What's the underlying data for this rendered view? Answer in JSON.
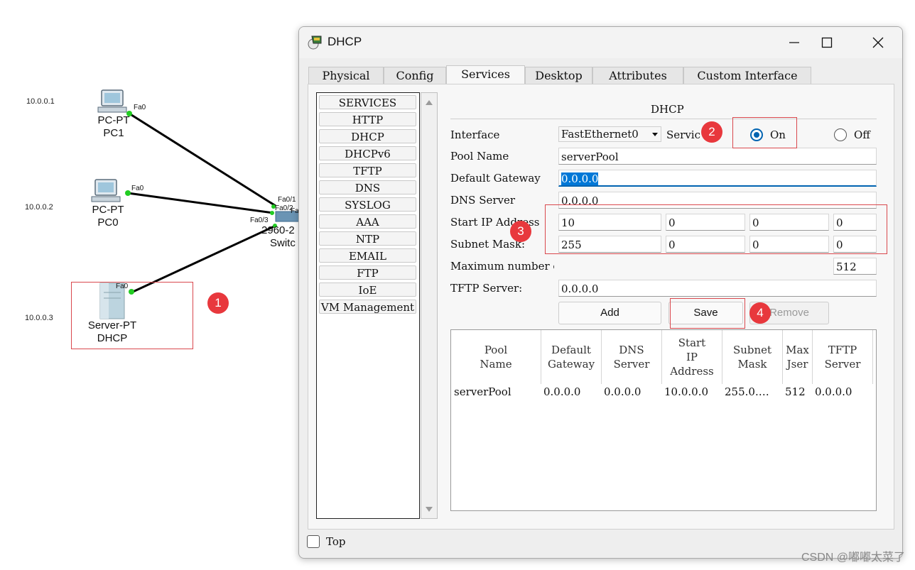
{
  "topology": {
    "ips": [
      "10.0.0.1",
      "10.0.0.2",
      "10.0.0.3"
    ],
    "nodes": {
      "pc1": {
        "type": "PC-PT",
        "name": "PC1",
        "port": "Fa0"
      },
      "pc0": {
        "type": "PC-PT",
        "name": "PC0",
        "port": "Fa0"
      },
      "server": {
        "type": "Server-PT",
        "name": "DHCP",
        "port": "Fa0"
      },
      "switch": {
        "type": "2960-2",
        "name": "Switc",
        "ports": [
          "Fa0/1",
          "Fa0/2",
          "Fa",
          "Fa0/3"
        ]
      }
    },
    "link_color": "#000000",
    "link_light_color": "#22cc22"
  },
  "badges": [
    "1",
    "2",
    "3",
    "4"
  ],
  "window": {
    "title": "DHCP",
    "tabs": [
      "Physical",
      "Config",
      "Services",
      "Desktop",
      "Attributes",
      "Custom Interface"
    ],
    "active_tab": "Services",
    "services": [
      "SERVICES",
      "HTTP",
      "DHCP",
      "DHCPv6",
      "TFTP",
      "DNS",
      "SYSLOG",
      "AAA",
      "NTP",
      "EMAIL",
      "FTP",
      "IoE",
      "VM Management"
    ],
    "dhcp": {
      "heading": "DHCP",
      "interface_label": "Interface",
      "interface_value": "FastEthernet0",
      "service_label": "Servic",
      "on_label": "On",
      "off_label": "Off",
      "service_state": "On",
      "pool_name_label": "Pool Name",
      "pool_name_value": "serverPool",
      "gateway_label": "Default Gateway",
      "gateway_value": "0.0.0.0",
      "dns_label": "DNS Server",
      "dns_value": "0.0.0.0",
      "start_ip_label": "Start IP Address",
      "start_ip": [
        "10",
        "0",
        "0",
        "0"
      ],
      "subnet_label": "Subnet Mask:",
      "subnet": [
        "255",
        "0",
        "0",
        "0"
      ],
      "max_users_label": "Maximum number o",
      "max_users_value": "512",
      "tftp_label": "TFTP Server:",
      "tftp_value": "0.0.0.0",
      "add_label": "Add",
      "save_label": "Save",
      "remove_label": "Remove"
    },
    "table": {
      "headers": [
        "Pool\nName",
        "Default\nGateway",
        "DNS\nServer",
        "Start\nIP\nAddress",
        "Subnet\nMask",
        "Max\nJser",
        "TFTP\nServer"
      ],
      "rows": [
        [
          "serverPool",
          "0.0.0.0",
          "0.0.0.0",
          "10.0.0.0",
          "255.0.…",
          "512",
          "0.0.0.0"
        ]
      ]
    },
    "top_label": "Top"
  },
  "watermark": "CSDN @嘟嘟太菜了",
  "colors": {
    "accent": "#0063b1",
    "annotation_red": "#e8383d",
    "highlight": "#0078d7"
  }
}
